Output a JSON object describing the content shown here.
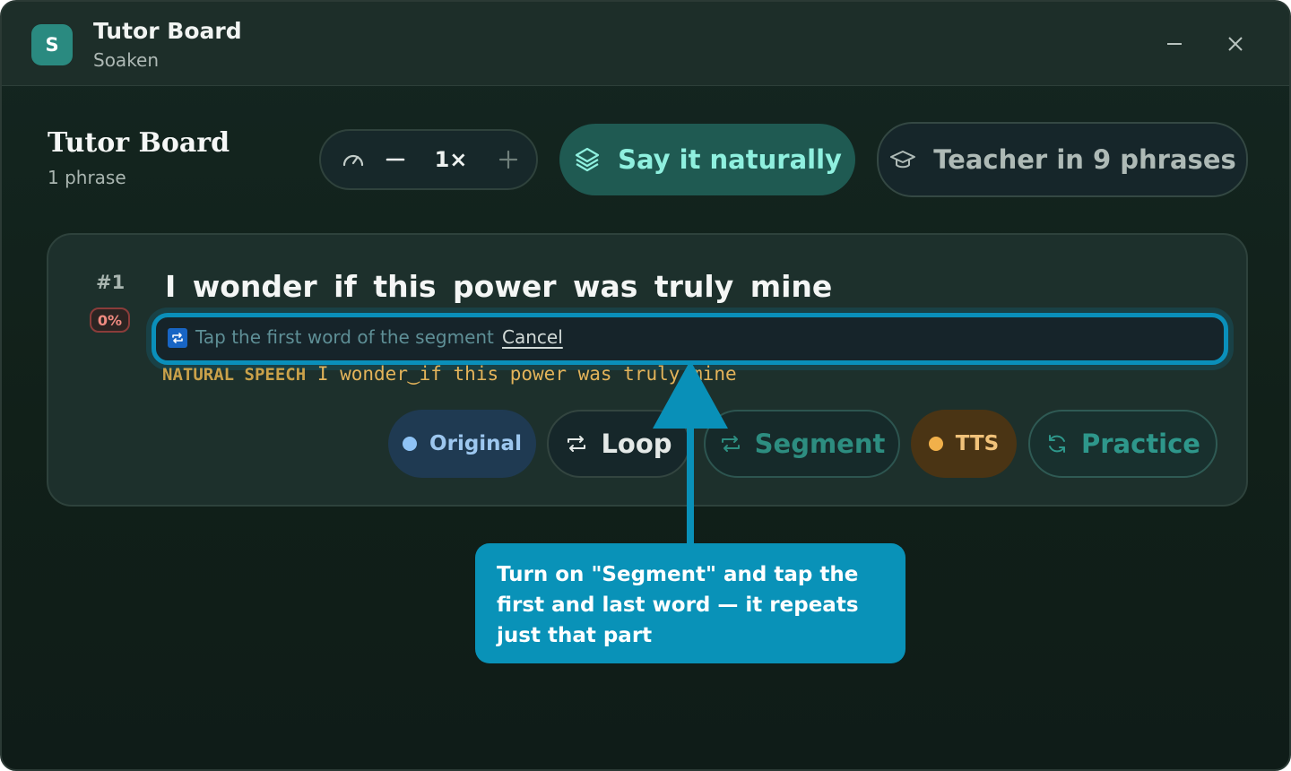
{
  "window": {
    "title": "Tutor Board",
    "subtitle": "Soaken",
    "icon_letter": "S",
    "controls": [
      "minimize-icon",
      "close-icon"
    ]
  },
  "header": {
    "title": "Tutor Board",
    "count": "1 phrase",
    "speed": {
      "value": "1×",
      "icon": "gauge-icon",
      "decrease_icon": "minus-icon",
      "increase_icon": "plus-icon"
    },
    "mode_active": {
      "label": "Say it naturally",
      "icon": "layers-icon"
    },
    "mode_other": {
      "label": "Teacher in 9 phrases",
      "icon": "graduation-cap-icon"
    }
  },
  "phrase": {
    "number": "#1",
    "progress": "0%",
    "text": "I wonder if this power was truly mine",
    "segment_prompt": {
      "hint": "Tap the first word of the segment",
      "cancel": "Cancel",
      "icon": "repeat-icon"
    },
    "natural_speech": {
      "label": "NATURAL SPEECH",
      "text": "I wonder‿if this power was truly mine"
    },
    "actions": {
      "original": "Original",
      "loop": "Loop",
      "segment": "Segment",
      "tts": "TTS",
      "practice": "Practice"
    }
  },
  "tooltip": {
    "text": "Turn on \"Segment\" and tap the first and last word — it repeats just that part"
  },
  "colors": {
    "accent": "#0a8fba",
    "active_mode_bg": "#1f5a52",
    "active_mode_text": "#8ff0df",
    "natural_text": "#e3b35a",
    "original_dot": "#8fc3f5",
    "tts_dot": "#f1b04a"
  }
}
